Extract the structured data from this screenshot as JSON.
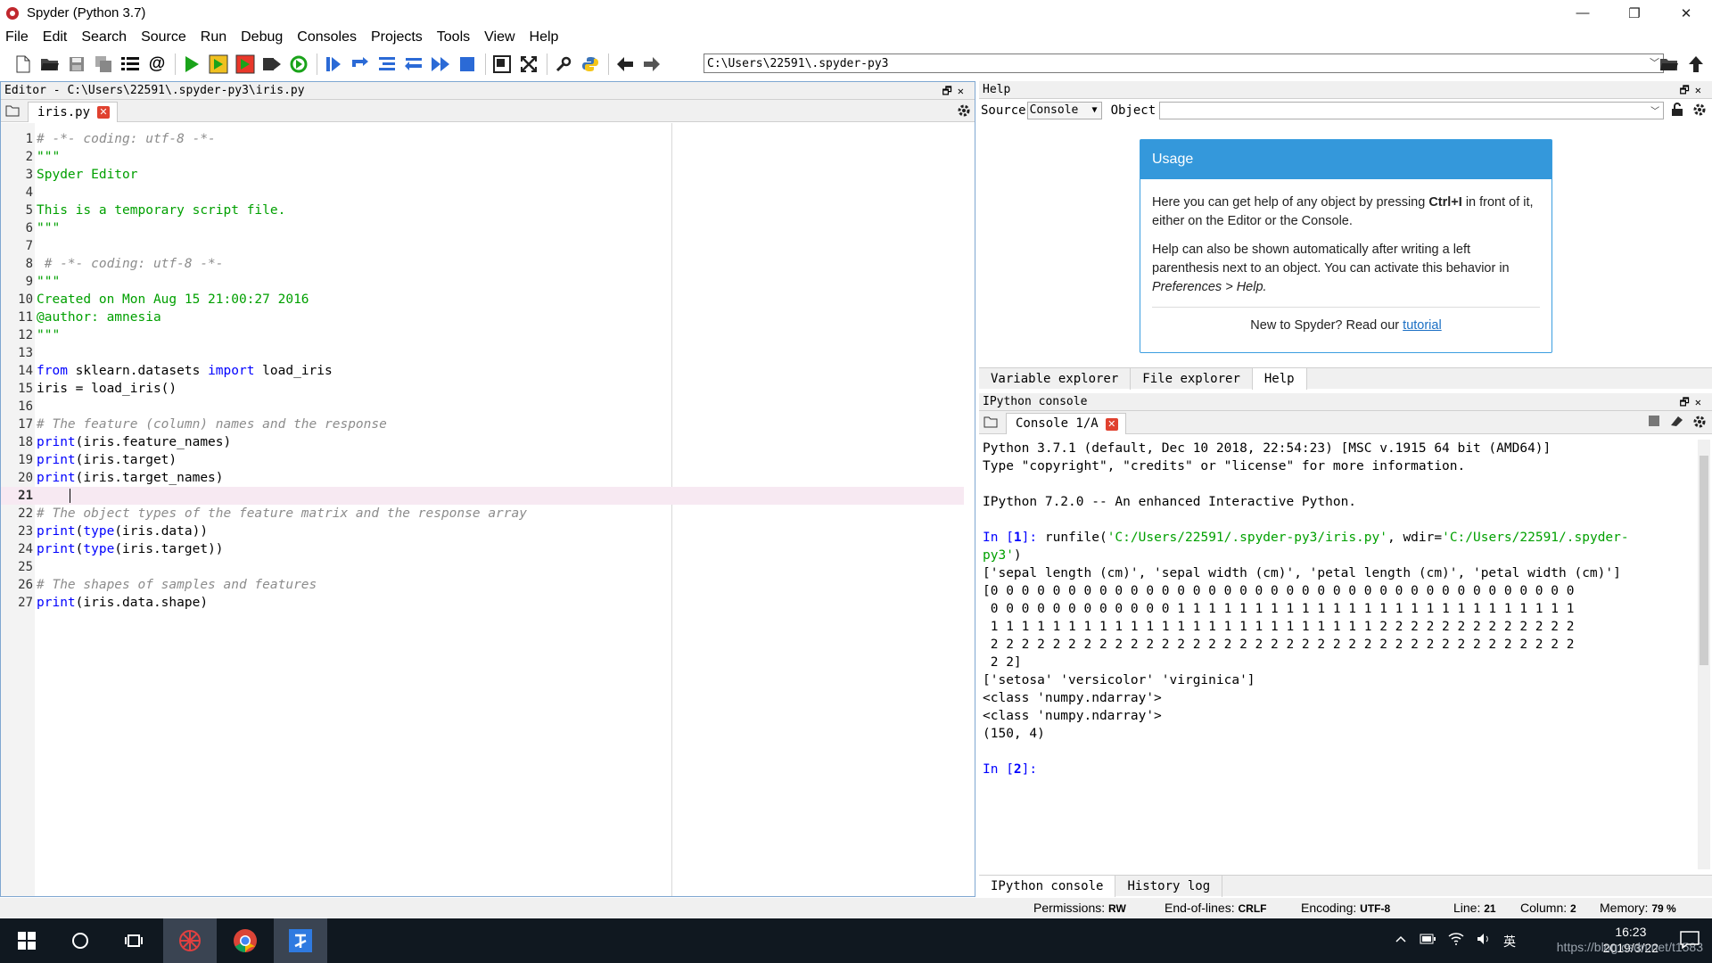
{
  "window": {
    "title": "Spyder (Python 3.7)"
  },
  "menu": [
    "File",
    "Edit",
    "Search",
    "Source",
    "Run",
    "Debug",
    "Consoles",
    "Projects",
    "Tools",
    "View",
    "Help"
  ],
  "toolbar": {
    "path": "C:\\Users\\22591\\.spyder-py3"
  },
  "editor": {
    "title": "Editor - C:\\Users\\22591\\.spyder-py3\\iris.py",
    "tab": "iris.py",
    "current_line": 21,
    "lines": [
      {
        "n": "1",
        "text": "# -*- coding: utf-8 -*-",
        "cls": "c-comment"
      },
      {
        "n": "2",
        "text": "\"\"\"",
        "cls": "c-string"
      },
      {
        "n": "3",
        "text": "Spyder Editor",
        "cls": "c-string"
      },
      {
        "n": "4",
        "text": "",
        "cls": "c-string"
      },
      {
        "n": "5",
        "text": "This is a temporary script file.",
        "cls": "c-string"
      },
      {
        "n": "6",
        "text": "\"\"\"",
        "cls": "c-string"
      },
      {
        "n": "7",
        "text": "",
        "cls": "c-text"
      },
      {
        "n": "8",
        "text": " # -*- coding: utf-8 -*-",
        "cls": "c-comment"
      },
      {
        "n": "9",
        "text": "\"\"\"",
        "cls": "c-string"
      },
      {
        "n": "10",
        "text": "Created on Mon Aug 15 21:00:27 2016",
        "cls": "c-string"
      },
      {
        "n": "11",
        "text": "@author: amnesia",
        "cls": "c-string"
      },
      {
        "n": "12",
        "text": "\"\"\"",
        "cls": "c-string"
      },
      {
        "n": "13",
        "text": "",
        "cls": "c-text"
      },
      {
        "n": "14",
        "text": "",
        "cls": "c-text",
        "parts": [
          [
            "from",
            "c-kw"
          ],
          [
            " sklearn.datasets ",
            "c-text"
          ],
          [
            "import",
            "c-kw"
          ],
          [
            " load_iris",
            "c-text"
          ]
        ]
      },
      {
        "n": "15",
        "text": "iris = load_iris()",
        "cls": "c-text"
      },
      {
        "n": "16",
        "text": "",
        "cls": "c-text"
      },
      {
        "n": "17",
        "text": "# The feature (column) names and the response",
        "cls": "c-comment"
      },
      {
        "n": "18",
        "text": "",
        "cls": "c-text",
        "parts": [
          [
            "print",
            "c-kw"
          ],
          [
            "(iris.feature_names)",
            "c-text"
          ]
        ]
      },
      {
        "n": "19",
        "text": "",
        "cls": "c-text",
        "parts": [
          [
            "print",
            "c-kw"
          ],
          [
            "(iris.target)",
            "c-text"
          ]
        ]
      },
      {
        "n": "20",
        "text": "",
        "cls": "c-text",
        "parts": [
          [
            "print",
            "c-kw"
          ],
          [
            "(iris.target_names)",
            "c-text"
          ]
        ]
      },
      {
        "n": "21",
        "text": "",
        "cls": "c-text"
      },
      {
        "n": "22",
        "text": "# The object types of the feature matrix and the response array",
        "cls": "c-comment"
      },
      {
        "n": "23",
        "text": "",
        "cls": "c-text",
        "parts": [
          [
            "print",
            "c-kw"
          ],
          [
            "(",
            "c-text"
          ],
          [
            "type",
            "c-kw"
          ],
          [
            "(iris.data))",
            "c-text"
          ]
        ]
      },
      {
        "n": "24",
        "text": "",
        "cls": "c-text",
        "parts": [
          [
            "print",
            "c-kw"
          ],
          [
            "(",
            "c-text"
          ],
          [
            "type",
            "c-kw"
          ],
          [
            "(iris.target))",
            "c-text"
          ]
        ]
      },
      {
        "n": "25",
        "text": "",
        "cls": "c-text"
      },
      {
        "n": "26",
        "text": "# The shapes of samples and features",
        "cls": "c-comment"
      },
      {
        "n": "27",
        "text": "",
        "cls": "c-text",
        "parts": [
          [
            "print",
            "c-kw"
          ],
          [
            "(iris.data.shape)",
            "c-text"
          ]
        ]
      }
    ]
  },
  "help": {
    "title": "Help",
    "source_label": "Source",
    "source_value": "Console",
    "object_label": "Object",
    "usage_title": "Usage",
    "p1a": "Here you can get help of any object by pressing ",
    "p1b": "Ctrl+I",
    "p1c": " in front of it, either on the Editor or the Console.",
    "p2a": "Help can also be shown automatically after writing a left parenthesis next to an object. You can activate this behavior in ",
    "p2b": "Preferences > Help.",
    "p3a": "New to Spyder? Read our ",
    "p3b": "tutorial",
    "tabs": [
      "Variable explorer",
      "File explorer",
      "Help"
    ]
  },
  "console": {
    "title": "IPython console",
    "tab": "Console 1/A",
    "tabs": [
      "IPython console",
      "History log"
    ],
    "out": {
      "l1": "Python 3.7.1 (default, Dec 10 2018, 22:54:23) [MSC v.1915 64 bit (AMD64)]",
      "l2": "Type \"copyright\", \"credits\" or \"license\" for more information.",
      "l3": "IPython 7.2.0 -- An enhanced Interactive Python.",
      "in1": "In [",
      "in1n": "1",
      "in1c": "]: ",
      "run1": "runfile(",
      "run2": "'C:/Users/22591/.spyder-py3/iris.py'",
      "run3": ", wdir=",
      "run4": "'C:/Users/22591/.spyder-",
      "run5": "py3'",
      "run6": ")",
      "o1": "['sepal length (cm)', 'sepal width (cm)', 'petal length (cm)', 'petal width (cm)']",
      "o2": "[0 0 0 0 0 0 0 0 0 0 0 0 0 0 0 0 0 0 0 0 0 0 0 0 0 0 0 0 0 0 0 0 0 0 0 0 0 0",
      "o3": " 0 0 0 0 0 0 0 0 0 0 0 0 1 1 1 1 1 1 1 1 1 1 1 1 1 1 1 1 1 1 1 1 1 1 1 1 1 1",
      "o4": " 1 1 1 1 1 1 1 1 1 1 1 1 1 1 1 1 1 1 1 1 1 1 1 1 1 2 2 2 2 2 2 2 2 2 2 2 2 2",
      "o5": " 2 2 2 2 2 2 2 2 2 2 2 2 2 2 2 2 2 2 2 2 2 2 2 2 2 2 2 2 2 2 2 2 2 2 2 2 2 2",
      "o6": " 2 2]",
      "o7": "['setosa' 'versicolor' 'virginica']",
      "o8": "<class 'numpy.ndarray'>",
      "o9": "<class 'numpy.ndarray'>",
      "o10": "(150, 4)",
      "in2": "In [",
      "in2n": "2",
      "in2c": "]:"
    }
  },
  "status": {
    "perm_label": "Permissions:",
    "perm": "RW",
    "eol_label": "End-of-lines:",
    "eol": "CRLF",
    "enc_label": "Encoding:",
    "enc": "UTF-8",
    "line_label": "Line:",
    "line": "21",
    "col_label": "Column:",
    "col": "2",
    "mem_label": "Memory:",
    "mem": "79 %"
  },
  "taskbar": {
    "time": "16:23",
    "date": "2019/3/22",
    "watermark": "https://blog.csdn.net/t1583"
  },
  "colors": {
    "accent": "#3498db",
    "string": "#00a000",
    "keyword": "#0000ff",
    "comment": "#8c8c8c"
  }
}
